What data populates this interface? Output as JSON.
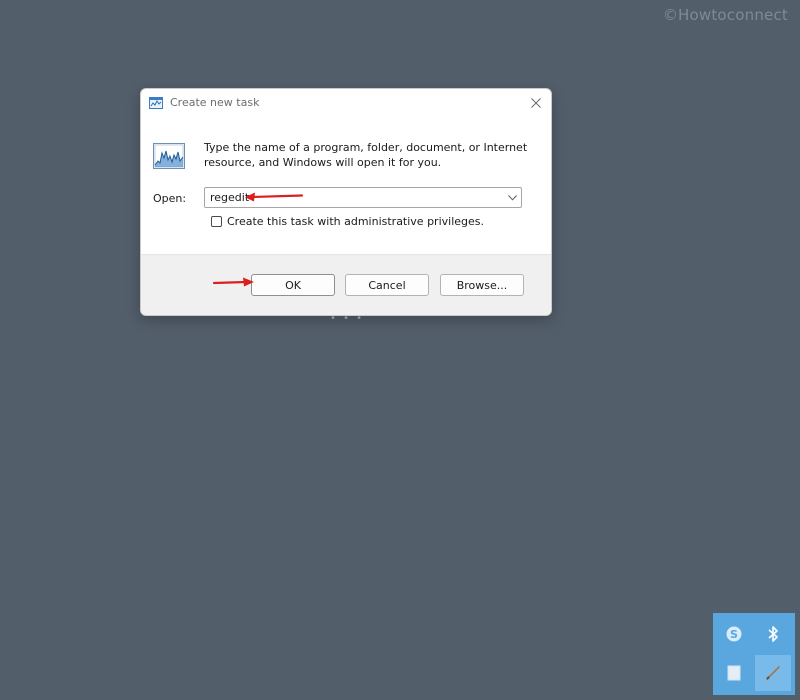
{
  "watermark": "©Howtoconnect",
  "dialog": {
    "title": "Create new task",
    "description": "Type the name of a program, folder, document, or Internet resource, and Windows will open it for you.",
    "open_label": "Open:",
    "open_value": "regedit",
    "admin_checkbox_label": "Create this task with administrative privileges.",
    "admin_checked": false,
    "buttons": {
      "ok": "OK",
      "cancel": "Cancel",
      "browse": "Browse..."
    }
  },
  "icons": {
    "title": "task-manager-icon",
    "app": "performance-graph-icon",
    "close": "close-icon",
    "dropdown": "chevron-down-icon",
    "tray": [
      "skype-icon",
      "bluetooth-icon",
      "tablet-icon",
      "pen-icon"
    ]
  },
  "colors": {
    "background": "#535e6b",
    "annotation_arrow": "#d9201f",
    "tray": "#5aa7e0"
  }
}
